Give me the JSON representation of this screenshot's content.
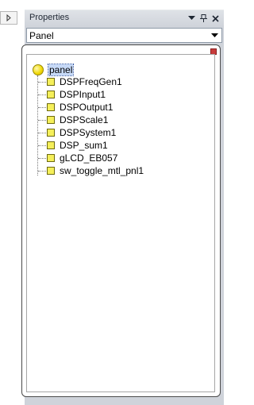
{
  "left_panel": {
    "expand_icon": "triangle-right-icon"
  },
  "properties": {
    "title": "Properties",
    "buttons": {
      "dropdown_icon": "menu-arrow-icon",
      "pin_icon": "pin-icon",
      "close_icon": "close-icon"
    },
    "selector": {
      "value": "Panel",
      "arrow_icon": "chevron-down-icon"
    }
  },
  "tree": {
    "root": {
      "label": "panel",
      "icon": "yellow-circle-icon"
    },
    "items": [
      {
        "label": "DSPFreqGen1"
      },
      {
        "label": "DSPInput1"
      },
      {
        "label": "DSPOutput1"
      },
      {
        "label": "DSPScale1"
      },
      {
        "label": "DSPSystem1"
      },
      {
        "label": "DSP_sum1"
      },
      {
        "label": "gLCD_EB057"
      },
      {
        "label": "sw_toggle_mtl_pnl1"
      }
    ]
  }
}
